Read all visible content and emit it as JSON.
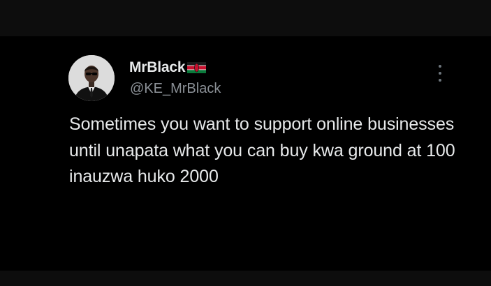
{
  "tweet": {
    "display_name": "MrBlack",
    "flag": "kenya-flag-icon",
    "handle": "@KE_MrBlack",
    "text": "Sometimes you want to support online businesses until unapata what you can buy kwa ground at 100 inauzwa huko 2000"
  },
  "icons": {
    "avatar": "profile-photo",
    "more": "more-options-icon"
  },
  "colors": {
    "background": "#000000",
    "text_primary": "#e7e9ea",
    "text_secondary": "#8b9096"
  }
}
